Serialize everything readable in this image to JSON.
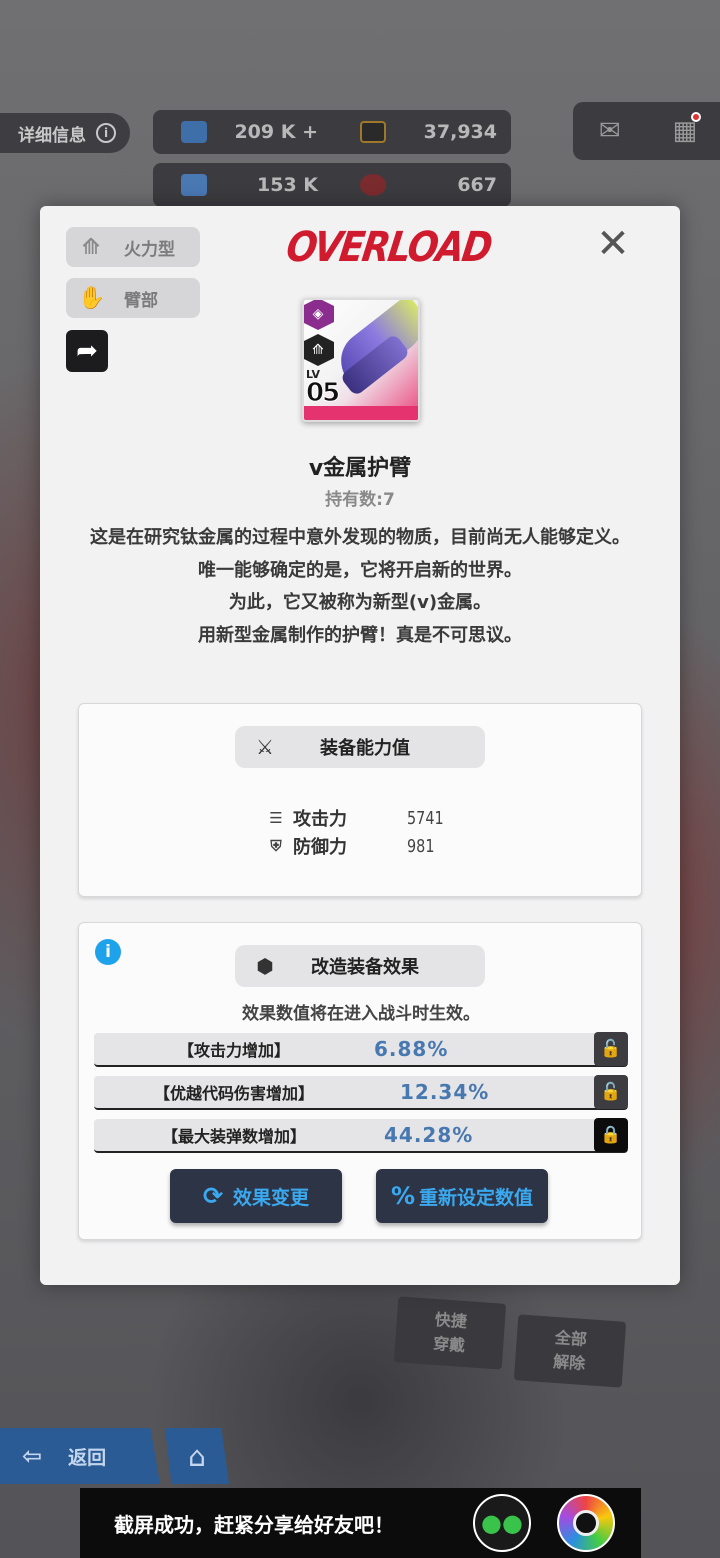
{
  "background": {
    "detail_label": "详细信息",
    "resources_row1": [
      {
        "icon": "crystal-icon",
        "value": "209 K +"
      },
      {
        "icon": "ticket-icon",
        "value": "37,934"
      }
    ],
    "resources_row2": [
      {
        "icon": "gear-part-icon",
        "value": "153 K"
      },
      {
        "icon": "core-icon",
        "value": "667"
      }
    ],
    "quick_equip": "快捷\n穿戴",
    "unequip_all": "全部\n解除",
    "back_label": "返回"
  },
  "toast": {
    "message": "截屏成功，赶紧分享给好友吧！"
  },
  "modal": {
    "tags": [
      "火力型",
      "臂部"
    ],
    "brand": "OVERLOAD",
    "item": {
      "name": "v金属护臂",
      "owned_label": "持有数:7",
      "level_label": "LV",
      "level_value": "05"
    },
    "description": [
      "这是在研究钛金属的过程中意外发现的物质，目前尚无人能够定义。",
      "唯一能够确定的是，它将开启新的世界。",
      "为此，它又被称为新型(v)金属。",
      "用新型金属制作的护臂！真是不可思议。"
    ],
    "equip_stats": {
      "title": "装备能力值",
      "rows": [
        {
          "label": "攻击力",
          "value": "5741"
        },
        {
          "label": "防御力",
          "value": "981"
        }
      ]
    },
    "mod_effects": {
      "title": "改造装备效果",
      "note": "效果数值将在进入战斗时生效。",
      "rows": [
        {
          "label": "【攻击力增加】",
          "value": "6.88%",
          "locked": false
        },
        {
          "label": "【优越代码伤害增加】",
          "value": "12.34%",
          "locked": false
        },
        {
          "label": "【最大装弹数增加】",
          "value": "44.28%",
          "locked": true
        }
      ],
      "change_button": "效果变更",
      "reset_button": "重新设定数值"
    }
  },
  "colors": {
    "brand_red": "#d01b2f",
    "accent_blue": "#3aa9ef",
    "value_blue": "#4878b0"
  }
}
